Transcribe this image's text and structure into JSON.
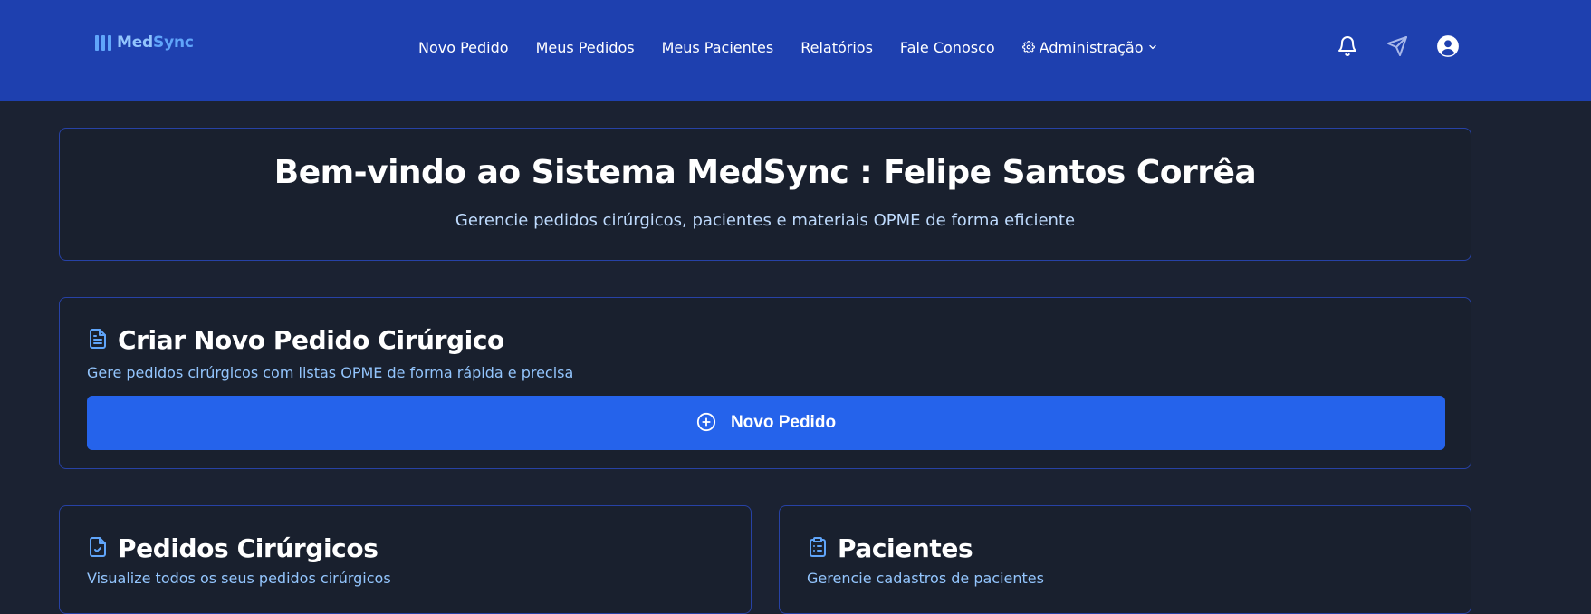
{
  "brand": {
    "name_part1": "Med",
    "name_part2": "Sync"
  },
  "nav": {
    "items": [
      {
        "label": "Novo Pedido"
      },
      {
        "label": "Meus Pedidos"
      },
      {
        "label": "Meus Pacientes"
      },
      {
        "label": "Relatórios"
      },
      {
        "label": "Fale Conosco"
      },
      {
        "label": "Administração",
        "icon": "gear-icon",
        "dropdown": true
      }
    ]
  },
  "header_icons": [
    "bell-icon",
    "send-icon",
    "user-circle-icon"
  ],
  "welcome": {
    "title": "Bem-vindo ao Sistema MedSync : Felipe Santos Corrêa",
    "subtitle": "Gerencie pedidos cirúrgicos, pacientes e materiais OPME de forma eficiente"
  },
  "create_order": {
    "icon": "document-icon",
    "title": "Criar Novo Pedido Cirúrgico",
    "description": "Gere pedidos cirúrgicos com listas OPME de forma rápida e precisa",
    "button_icon": "plus-circle-icon",
    "button_label": "Novo Pedido"
  },
  "surgical_orders": {
    "icon": "file-check-icon",
    "title": "Pedidos Cirúrgicos",
    "description": "Visualize todos os seus pedidos cirúrgicos"
  },
  "patients": {
    "icon": "clipboard-list-icon",
    "title": "Pacientes",
    "description": "Gerencie cadastros de pacientes"
  },
  "colors": {
    "header_bg": "#1e40af",
    "page_bg": "#1b2232",
    "card_border": "#2742a6",
    "primary_button": "#2563eb",
    "accent_text": "#93c5fd"
  }
}
